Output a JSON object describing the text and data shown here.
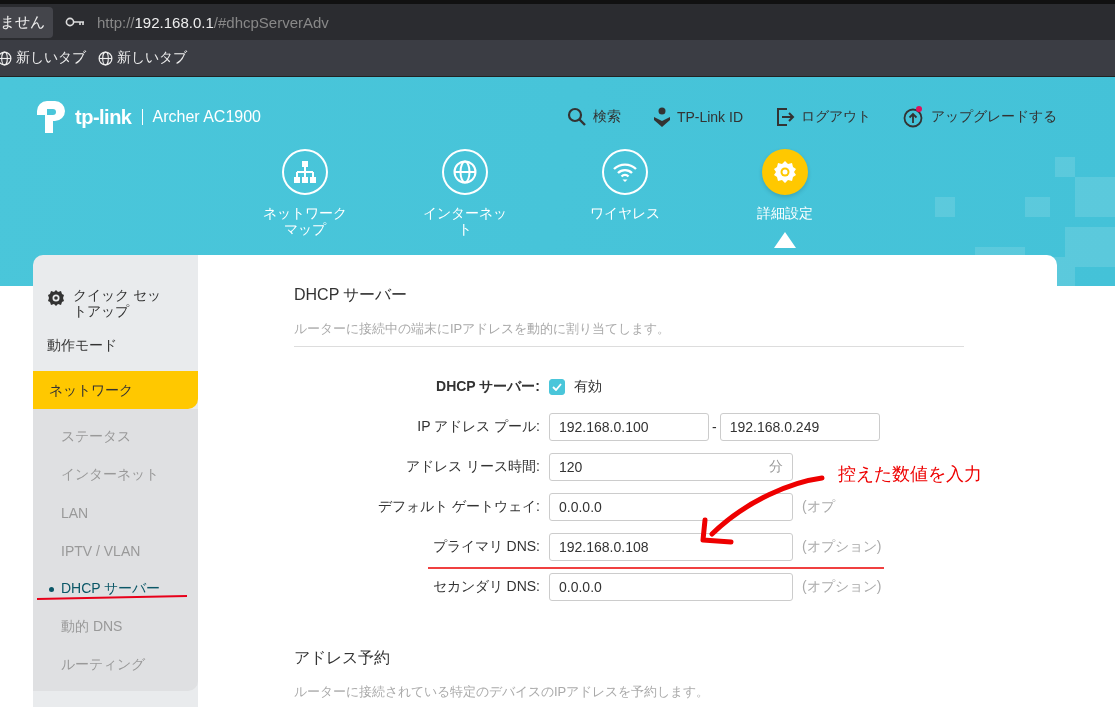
{
  "browser": {
    "tab_fragment": "ません",
    "url": {
      "scheme": "http://",
      "host": "192.168.0.1",
      "path": "/#dhcpServerAdv"
    },
    "bookmarks": [
      {
        "label": "新しいタブ"
      },
      {
        "label": "新しいタブ"
      }
    ]
  },
  "header": {
    "brand": "tp-link",
    "model": "Archer AC1900",
    "links": [
      {
        "label": "検索",
        "kind": "search",
        "notification": false
      },
      {
        "label": "TP-Link ID",
        "kind": "id",
        "notification": false
      },
      {
        "label": "ログアウト",
        "kind": "logout",
        "notification": false
      },
      {
        "label": "アップグレードする",
        "kind": "upgrade",
        "notification": true
      }
    ],
    "nav": [
      {
        "label": "ネットワークマップ",
        "kind": "map",
        "selected": false
      },
      {
        "label": "インターネット",
        "kind": "globe",
        "selected": false
      },
      {
        "label": "ワイヤレス",
        "kind": "wifi",
        "selected": false
      },
      {
        "label": "詳細設定",
        "kind": "gear",
        "selected": true
      }
    ]
  },
  "sidebar": {
    "items": [
      {
        "label": "クイック セットアップ",
        "kind": "quick",
        "selected": false
      },
      {
        "label": "動作モード",
        "kind": "plain",
        "selected": false
      },
      {
        "label": "ネットワーク",
        "kind": "plain",
        "selected": true,
        "children": [
          {
            "label": "ステータス",
            "selected": false
          },
          {
            "label": "インターネット",
            "selected": false
          },
          {
            "label": "LAN",
            "selected": false
          },
          {
            "label": "IPTV / VLAN",
            "selected": false
          },
          {
            "label": "DHCP サーバー",
            "selected": true
          },
          {
            "label": "動的 DNS",
            "selected": false
          },
          {
            "label": "ルーティング",
            "selected": false
          }
        ]
      }
    ]
  },
  "sections": [
    {
      "title": "DHCP サーバー",
      "description": "ルーターに接続中の端末にIPアドレスを動的に割り当てします。",
      "rows": [
        {
          "kind": "checkbox",
          "label": "DHCP サーバー:",
          "checked": true,
          "text": "有効"
        },
        {
          "kind": "range",
          "label": "IP アドレス プール:",
          "value": "192.168.0.100",
          "separator": "-",
          "value_2": "192.168.0.249"
        },
        {
          "kind": "suffix",
          "label": "アドレス リース時間:",
          "value": "120",
          "suffix": "分"
        },
        {
          "kind": "text",
          "label": "デフォルト ゲートウェイ:",
          "value": "0.0.0.0",
          "hint": "(オプ"
        },
        {
          "kind": "text",
          "label": "プライマリ DNS:",
          "value": "192.168.0.108",
          "hint": "(オプション)"
        },
        {
          "kind": "text",
          "label": "セカンダリ DNS:",
          "value": "0.0.0.0",
          "hint": "(オプション)"
        }
      ]
    },
    {
      "title": "アドレス予約",
      "description": "ルーターに接続されている特定のデバイスのIPアドレスを予約します。"
    }
  ],
  "annotation": {
    "note": "控えた数値を入力"
  }
}
